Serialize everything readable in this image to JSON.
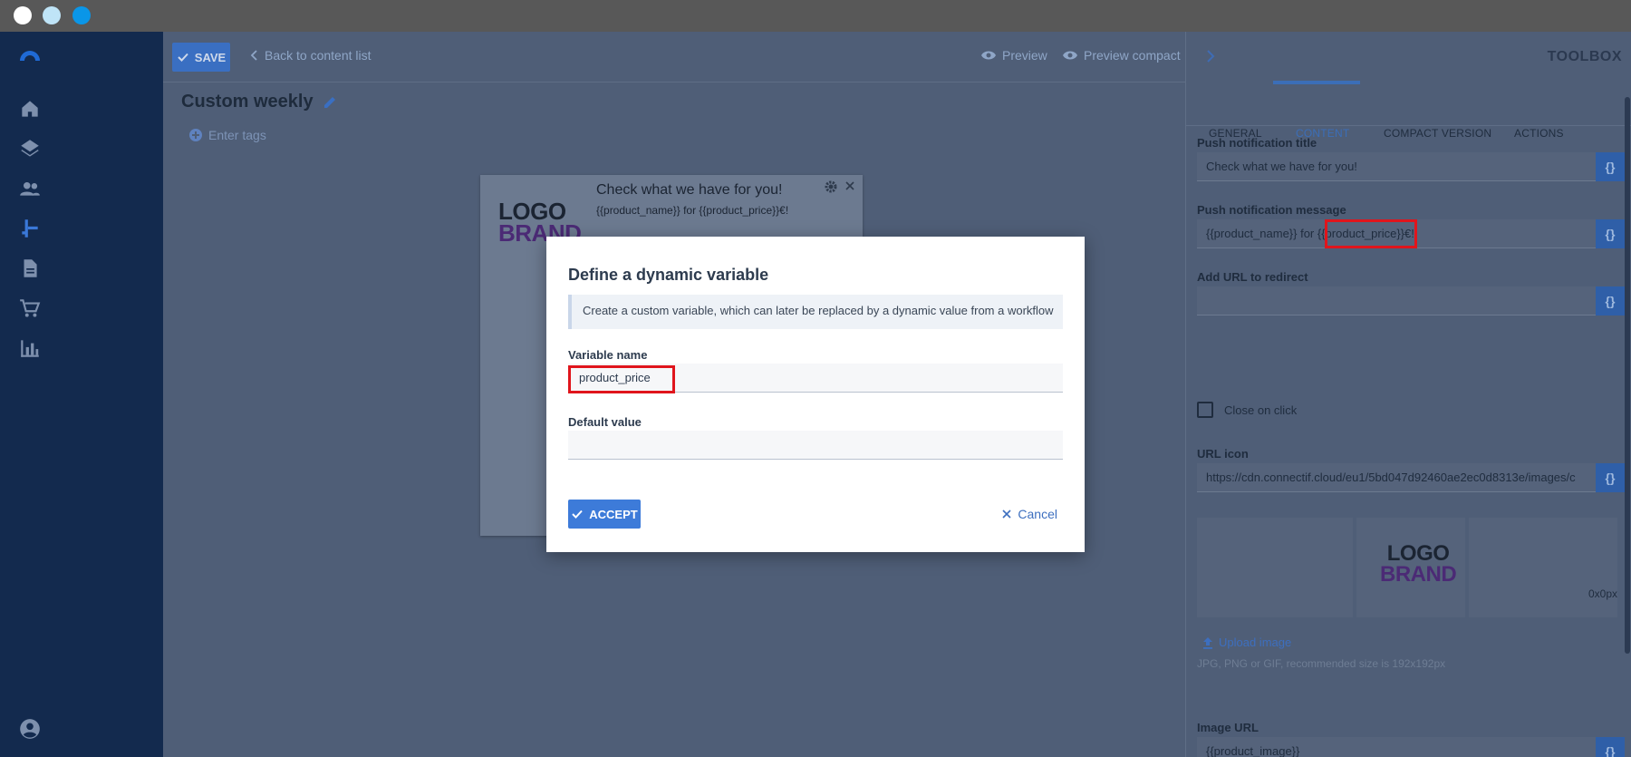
{
  "window": {
    "dots": [
      "close",
      "minimize",
      "maximize"
    ]
  },
  "nav": {
    "icons": [
      "app-logo-icon",
      "home-icon",
      "layers-icon",
      "contacts-icon",
      "workflow-icon",
      "content-icon",
      "store-icon",
      "reports-icon",
      "account-icon"
    ]
  },
  "toolbar": {
    "save_label": "SAVE",
    "back_label": "Back to content list",
    "preview_label": "Preview",
    "preview_compact_label": "Preview compact"
  },
  "page": {
    "title": "Custom weekly",
    "tags_label": "Enter tags"
  },
  "notification_preview": {
    "logo_line1": "LOGO",
    "logo_line2": "BRAND",
    "title": "Check what we have for you!",
    "message": "{{product_name}} for {{product_price}}€!"
  },
  "modal": {
    "title": "Define a dynamic variable",
    "info": "Create a custom variable, which can later be replaced by a dynamic value from a workflow",
    "variable_name_label": "Variable name",
    "variable_name_value": "product_price",
    "default_value_label": "Default value",
    "default_value_value": "",
    "accept_label": "ACCEPT",
    "cancel_label": "Cancel"
  },
  "toolbox": {
    "title": "TOOLBOX",
    "tabs": [
      {
        "label": "GENERAL",
        "active": false
      },
      {
        "label": "CONTENT",
        "active": true
      },
      {
        "label": "COMPACT VERSION",
        "active": false
      },
      {
        "label": "ACTIONS",
        "active": false
      }
    ],
    "push_title_label": "Push notification title",
    "push_title_value": "Check what we have for you!",
    "push_message_label": "Push notification message",
    "push_message_value": "{{product_name}} for {{product_price}}€!",
    "redirect_label": "Add URL to redirect",
    "redirect_value": "",
    "close_on_click_label": "Close on click",
    "url_icon_label": "URL icon",
    "url_icon_value": "https://cdn.connectif.cloud/eu1/5bd047d92460ae2ec0d8313e/images/c",
    "image_size": "0x0px",
    "upload_label": "Upload image",
    "upload_hint": "JPG, PNG or GIF, recommended size is 192x192px",
    "image_url_label": "Image URL",
    "image_url_value": "{{product_image}}",
    "variable_button": "{}"
  },
  "colors": {
    "accent": "#3d7bd9",
    "highlight": "#e0151c",
    "nav_bg": "#132a4e"
  }
}
